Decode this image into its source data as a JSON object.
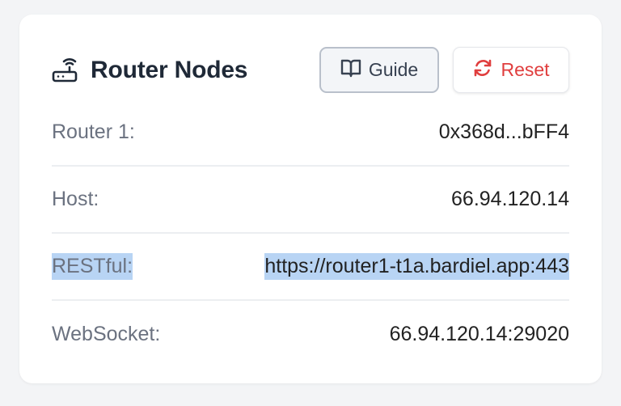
{
  "header": {
    "title": "Router Nodes",
    "router_icon": "router-icon",
    "guide_label": "Guide",
    "guide_icon": "book-open-icon",
    "reset_label": "Reset",
    "reset_icon": "refresh-icon"
  },
  "rows": [
    {
      "label": "Router 1:",
      "value": "0x368d...bFF4"
    },
    {
      "label": "Host:",
      "value": "66.94.120.14"
    },
    {
      "label": "RESTful:",
      "value": "https://router1-t1a.bardiel.app:443"
    },
    {
      "label": "WebSocket:",
      "value": "66.94.120.14:29020"
    }
  ],
  "colors": {
    "reset_accent": "#e03e3e",
    "selection_highlight": "#b8d4f4"
  }
}
